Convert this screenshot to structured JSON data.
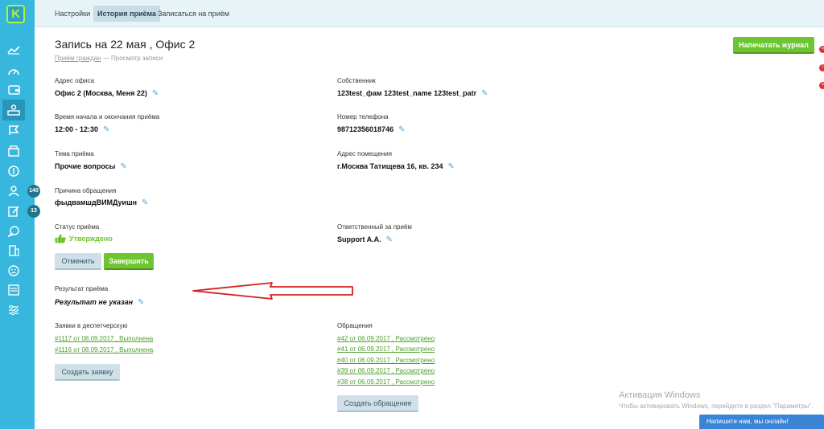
{
  "app": {
    "logo_letter": "K"
  },
  "sidebar": {
    "icons": [
      "chart-icon",
      "gauge-icon",
      "wallet-icon",
      "reception-icon",
      "flag-icon",
      "box-icon",
      "coin-icon",
      "people-icon",
      "edit-icon",
      "chat-icon",
      "building-icon",
      "sad-face-icon",
      "news-icon",
      "sliders-icon"
    ],
    "badges": [
      "140",
      "13"
    ]
  },
  "tabs": [
    "Настройки",
    "История приёма",
    "Записаться на приём"
  ],
  "page": {
    "title": "Запись на 22 мая , Офис 2",
    "breadcrumb_link": "Приём граждан",
    "breadcrumb_current": "— Просмотр записи",
    "print_button": "Напечатать журнал"
  },
  "fields": {
    "office_label": "Адрес офиса",
    "office_value": "Офис 2 (Москва, Меня 22)",
    "owner_label": "Собственник",
    "owner_value": "123test_фам 123test_name 123test_patr",
    "time_label": "Время начала и окончания приёма",
    "time_value": "12:00 - 12:30",
    "phone_label": "Номер телефона",
    "phone_value": "98712356018746",
    "topic_label": "Тема приёма",
    "topic_value": "Прочие вопросы",
    "address_label": "Адрес помещения",
    "address_value": "г.Москва Татищева 16, кв. 234",
    "reason_label": "Причина обращения",
    "reason_value": "фыдвамшдВИМДуишн",
    "status_label": "Статус приёма",
    "status_value": "Утверждено",
    "responsible_label": "Ответственный за приём",
    "responsible_value": "Support A.A.",
    "result_label": "Результат приёма",
    "result_value": "Результат не указан"
  },
  "actions": {
    "cancel": "Отменить",
    "finish": "Завершить"
  },
  "requests": {
    "label": "Заявки в деспетчерскую",
    "items": [
      "#1117 от 08.09.2017 , Выполнена",
      "#1116 от 08.09.2017 , Выполнена"
    ],
    "create_button": "Создать заявку"
  },
  "appeals": {
    "label": "Обращения",
    "items": [
      "#42 от 06.09.2017 , Рассмотрено",
      "#41 от 06.09.2017 , Рассмотрено",
      "#40 от 06.09.2017 , Рассмотрено",
      "#39 от 06.09.2017 , Рассмотрено",
      "#38 от 06.09.2017 , Рассмотрено"
    ],
    "create_button": "Создать обращение"
  },
  "windows_activation": {
    "title": "Активация Windows",
    "subtitle": "Чтобы активировать Windows, перейдите в раздел \"Параметры\"."
  },
  "chat_widget": "Напишите нам, мы онлайн!",
  "colors": {
    "sidebar": "#37b7dd",
    "accent_green": "#6ec531",
    "link_green": "#4fa02f",
    "arrow_red": "#d42020"
  }
}
